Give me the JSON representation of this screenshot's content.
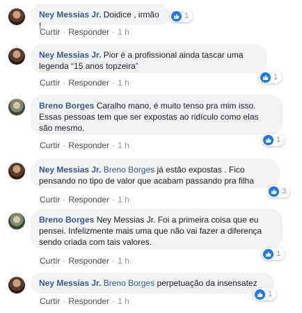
{
  "colors": {
    "author": "#385898",
    "bubble": "#f2f3f5",
    "like": "#1877f2",
    "meta": "#90949c"
  },
  "actions": {
    "like": "Curtir",
    "reply": "Responder",
    "sep": "·"
  },
  "comments": [
    {
      "author": "Ney Messias Jr.",
      "tag": "",
      "text": "Doidice , irmão !",
      "lines": [
        "Doidice , irmão !"
      ],
      "time": "1 h",
      "reactions": "1"
    },
    {
      "author": "Ney Messias Jr.",
      "tag": "",
      "lines": [
        "Pior é a profissional ainda tascar uma",
        "legenda “15 anos topzeira”"
      ],
      "time": "1 h",
      "reactions": "1"
    },
    {
      "author": "Breno Borges",
      "tag": "",
      "lines": [
        "Caralho mano, é muito tenso pra mim isso.",
        "Essas pessoas tem que ser expostas ao ridículo como elas",
        "são mesmo."
      ],
      "time": "1 h",
      "reactions": "1"
    },
    {
      "author": "Ney Messias Jr.",
      "tag": "Breno Borges",
      "lines": [
        "já estão expostas . Fico",
        "pensando no tipo de valor que acabam passando pra filha"
      ],
      "time": "1 h",
      "reactions": "3"
    },
    {
      "author": "Breno Borges",
      "tag": "",
      "lines": [
        "Ney Messias Jr. Foi a primeira coisa que eu",
        "pensei. Infelizmente mais uma que não vai fazer a diferença",
        "sendo criada com tais valores."
      ],
      "time": "1 h",
      "reactions": "1"
    },
    {
      "author": "Ney Messias Jr.",
      "tag": "Breno Borges",
      "lines": [
        "perpetuação da insensatez"
      ],
      "time": "1 h",
      "reactions": "1"
    }
  ]
}
